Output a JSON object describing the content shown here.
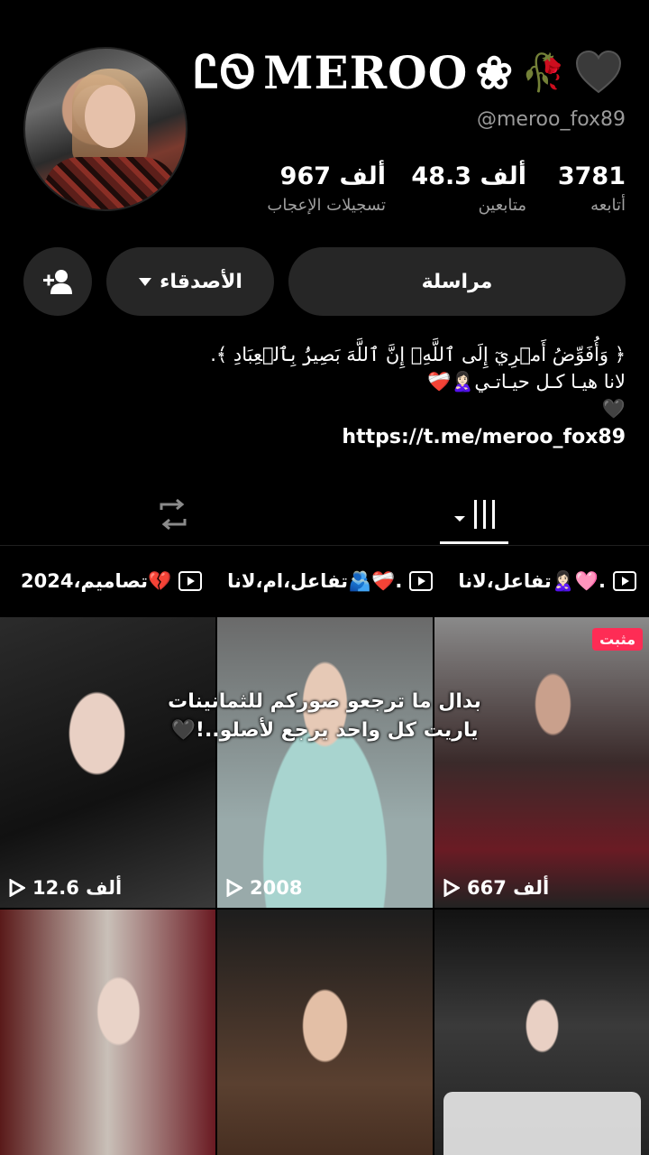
{
  "profile": {
    "display_name": "MEROO",
    "name_prefix_glyph": "ᏝᏫ",
    "name_flower": "❀",
    "name_rose": "🥀",
    "handle": "@meroo_fox89"
  },
  "stats": {
    "following": {
      "value": "3781",
      "label": "أتابعه"
    },
    "followers": {
      "value": "48.3 ألف",
      "label": "متابعين"
    },
    "likes": {
      "value": "967 ألف",
      "label": "تسجيلات الإعجاب"
    }
  },
  "actions": {
    "message_label": "مراسلة",
    "friends_label": "الأصدقاء"
  },
  "bio": {
    "line1": "﴿ وَأُفَوِّضُ أَمۡرِيٓ إِلَى ٱللَّهِۚ إِنَّ ٱللَّهَ بَصِيرُۢ بِٱلۡعِبَادِ ﴾.",
    "line2": "لانا هيـا كـل حيـاتـي🙎🏻‍♀️❤️‍🩹",
    "line3": "🖤",
    "link": "https://t.me/meroo_fox89"
  },
  "playlists": [
    {
      "label": "تفاعل،لانا🙎🏻‍♀️🩷."
    },
    {
      "label": "تفاعل،ام،لانا🫂❤️‍🩹."
    },
    {
      "label": "تصاميم،2024💔"
    }
  ],
  "grid": {
    "overlay_text_line1": "بدال ما ترجعو صوركم للثمانينات",
    "overlay_text_line2": "ياريت كل واحد يرجع لأصلو..!🖤",
    "videos": [
      {
        "views": "12.6 ألف"
      },
      {
        "views": "2008"
      },
      {
        "views": "667 ألف",
        "badge": "مثبت"
      },
      {
        "views": ""
      },
      {
        "views": ""
      },
      {
        "views": ""
      }
    ]
  },
  "colors": {
    "background": "#000000",
    "button": "#262626",
    "pinned": "#fe2c55",
    "muted": "#9a9a9a"
  }
}
